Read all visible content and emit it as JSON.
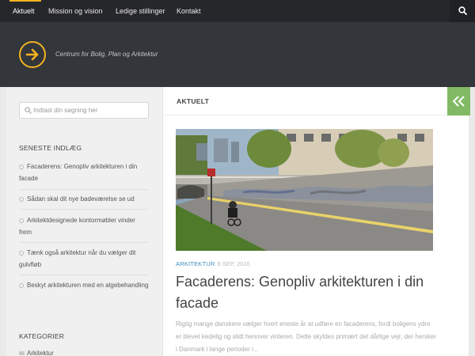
{
  "nav": {
    "items": [
      {
        "label": "Aktuelt",
        "active": true
      },
      {
        "label": "Mission og vision",
        "active": false
      },
      {
        "label": "Ledige stillinger",
        "active": false
      },
      {
        "label": "Kontakt",
        "active": false
      }
    ],
    "search_icon": "search-icon"
  },
  "header": {
    "logo_icon": "arrow-right-circle-icon",
    "tagline": "Centrum for Bolig, Plan og Arkitektur"
  },
  "colors": {
    "accent": "#f3b31f",
    "toggle_green": "#82b965",
    "link_blue": "#3b8dbd",
    "nav_bg": "#26272b",
    "header_bg": "#33363b"
  },
  "sidebar": {
    "search_placeholder": "Indtast din søgning her",
    "recent_title": "SENESTE INDLÆG",
    "recent_posts": [
      "Facaderens: Genopliv arkitekturen i din facade",
      "Sådan skal dit nye badeværelse se ud",
      "Arkitektdesignede kontormøbler vinder frem",
      "Tænk også arkitektur når du vælger dit gulvfløb",
      "Beskyt arkitekturen med en algebehandling"
    ],
    "categories_title": "KATEGORIER",
    "categories": [
      "Arkitektur"
    ]
  },
  "main": {
    "section_title": "AKTUELT",
    "toggle_icon": "double-chevron-left-icon",
    "post": {
      "category": "ARKITEKTUR",
      "date": "8 SEP, 2016",
      "title": "Facaderens: Genopliv arkitekturen i din facade",
      "excerpt": "Rigtig mange danskere vælger hvert eneste år at udføre en facaderens, fordi boligens ydre er blevet kedelig og slidt henover vinteren. Dette skyldes primært det dårlige vejr, der hersker i Danmark i lange perioder i..."
    }
  }
}
